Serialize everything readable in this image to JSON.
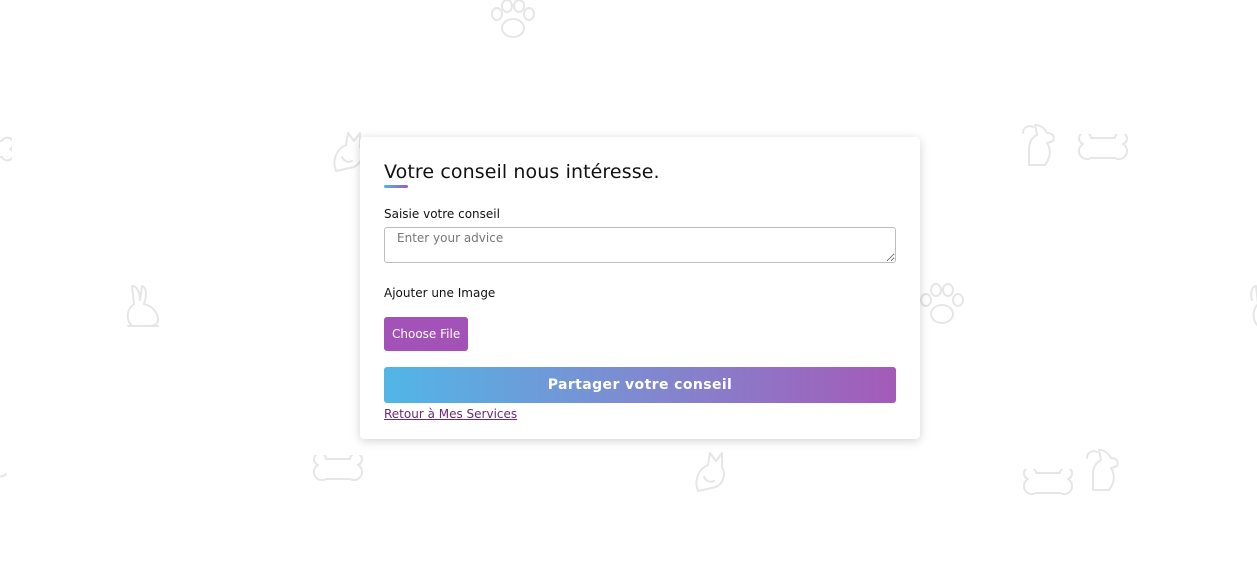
{
  "form": {
    "title": "Votre conseil nous intéresse.",
    "advice_label": "Saisie votre conseil",
    "advice_placeholder": "Enter your advice",
    "advice_value": "",
    "image_label": "Ajouter une Image",
    "file_button_label": "Choose File",
    "submit_label": "Partager votre conseil",
    "back_link_label": "Retour à Mes Services"
  },
  "theme": {
    "accent_purple": "#a353b7",
    "gradient_start": "#51b6e7",
    "gradient_end": "#a45ab8",
    "link_color": "#6a2a7a",
    "background_icon_color": "#e6e6e6"
  },
  "background_icons": [
    "paw-icon",
    "bone-icon",
    "dog-icon",
    "cat-icon",
    "rabbit-icon"
  ]
}
